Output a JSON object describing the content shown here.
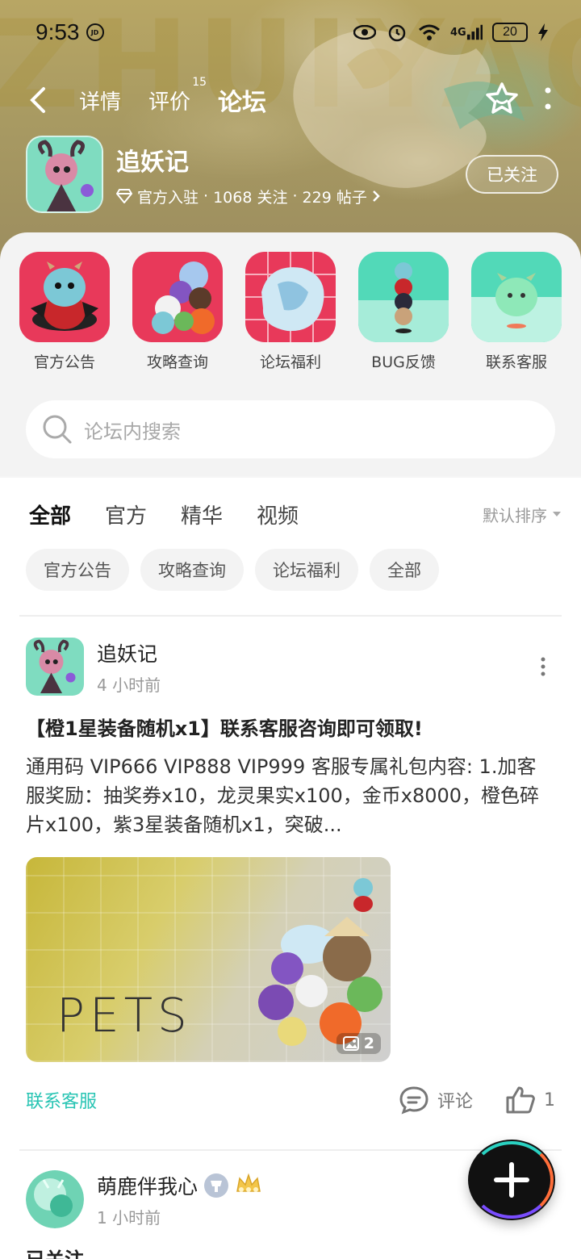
{
  "status_bar": {
    "time": "9:53",
    "app_badge": "JD",
    "network": "4G",
    "battery": "20"
  },
  "nav": {
    "tabs": [
      {
        "label": "详情"
      },
      {
        "label": "评价",
        "count": "15"
      },
      {
        "label": "论坛"
      }
    ],
    "active_tab": "论坛"
  },
  "game": {
    "title": "追妖记",
    "official": "官方入驻",
    "followers": "1068 关注",
    "posts": "229 帖子",
    "follow_label": "已关注"
  },
  "quick_menu": [
    {
      "label": "官方公告",
      "icon": "blue-dragon-mascot"
    },
    {
      "label": "攻略查询",
      "icon": "pets-group"
    },
    {
      "label": "论坛福利",
      "icon": "ice-creature"
    },
    {
      "label": "BUG反馈",
      "icon": "totem-stack"
    },
    {
      "label": "联系客服",
      "icon": "green-dragon-mascot"
    }
  ],
  "search": {
    "placeholder": "论坛内搜索"
  },
  "feed_tabs": [
    "全部",
    "官方",
    "精华",
    "视频"
  ],
  "sort_label": "默认排序",
  "filter_chips": [
    "官方公告",
    "攻略查询",
    "论坛福利",
    "全部"
  ],
  "posts": [
    {
      "author": "追妖记",
      "time": "4 小时前",
      "title": "【橙1星装备随机x1】联系客服咨询即可领取!",
      "body": "通用码 VIP666 VIP888 VIP999 客服专属礼包内容: 1.加客服奖励：抽奖券x10，龙灵果实x100，金币x8000，橙色碎片x100，紫3星装备随机x1，突破...",
      "image_text": "PETS",
      "image_count": "2",
      "tag": "联系客服",
      "comment_label": "评论",
      "likes": "1"
    },
    {
      "author": "萌鹿伴我心",
      "time": "1 小时前",
      "body_preview": "已关注"
    }
  ],
  "colors": {
    "accent": "#27c4b3",
    "header": "#a89a62"
  }
}
